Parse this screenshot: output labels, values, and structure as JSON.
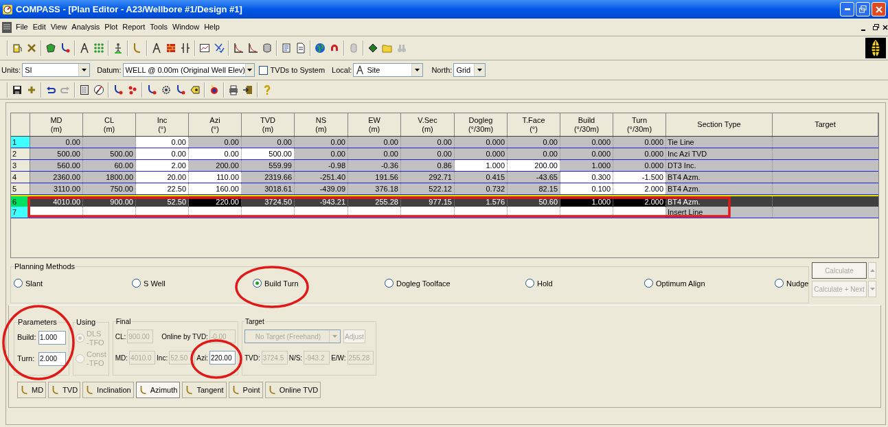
{
  "window": {
    "title": "COMPASS - [Plan Editor - A23/Wellbore #1/Design #1]"
  },
  "menu": [
    "File",
    "Edit",
    "View",
    "Analysis",
    "Plot",
    "Report",
    "Tools",
    "Window",
    "Help"
  ],
  "options": {
    "units": {
      "label": "Units:",
      "value": "SI"
    },
    "datum": {
      "label": "Datum:",
      "value": "WELL @ 0.00m (Original Well Elev)"
    },
    "tvds_to_system": {
      "label": "TVDs to System",
      "checked": false
    },
    "local": {
      "label": "Local:",
      "value": "Site"
    },
    "north": {
      "label": "North:",
      "value": "Grid"
    }
  },
  "table": {
    "columns": [
      {
        "name": "MD",
        "unit": "(m)"
      },
      {
        "name": "CL",
        "unit": "(m)"
      },
      {
        "name": "Inc",
        "unit": "(°)"
      },
      {
        "name": "Azi",
        "unit": "(°)"
      },
      {
        "name": "TVD",
        "unit": "(m)"
      },
      {
        "name": "NS",
        "unit": "(m)"
      },
      {
        "name": "EW",
        "unit": "(m)"
      },
      {
        "name": "V.Sec",
        "unit": "(m)"
      },
      {
        "name": "Dogleg",
        "unit": "(°/30m)"
      },
      {
        "name": "T.Face",
        "unit": "(°)"
      },
      {
        "name": "Build",
        "unit": "(°/30m)"
      },
      {
        "name": "Turn",
        "unit": "(°/30m)"
      },
      {
        "name": "Section Type"
      },
      {
        "name": "Target"
      }
    ],
    "rows": [
      {
        "number": "1",
        "kind": "tie",
        "selected": false,
        "section_type": "Tie Line",
        "cells": [
          {
            "text": "0.00",
            "editable": false
          },
          {
            "editable": false
          },
          {
            "text": "0.00",
            "editable": true
          },
          {
            "text": "0.00",
            "editable": false
          },
          {
            "text": "0.00",
            "editable": false
          },
          {
            "text": "0.00",
            "editable": false
          },
          {
            "text": "0.00",
            "editable": false
          },
          {
            "text": "0.00",
            "editable": false
          },
          {
            "text": "0.000",
            "editable": false
          },
          {
            "text": "0.00",
            "editable": false
          },
          {
            "text": "0.000",
            "editable": false
          },
          {
            "text": "0.000",
            "editable": false
          }
        ]
      },
      {
        "number": "2",
        "kind": "plan",
        "selected": false,
        "section_type": "Inc Azi TVD",
        "cells": [
          {
            "text": "500.00",
            "editable": false
          },
          {
            "text": "500.00",
            "editable": false
          },
          {
            "text": "0.00",
            "editable": true
          },
          {
            "text": "0.00",
            "editable": true
          },
          {
            "text": "500.00",
            "editable": true
          },
          {
            "text": "0.00",
            "editable": false
          },
          {
            "text": "0.00",
            "editable": false
          },
          {
            "text": "0.00",
            "editable": false
          },
          {
            "text": "0.000",
            "editable": false
          },
          {
            "text": "0.00",
            "editable": false
          },
          {
            "text": "0.000",
            "editable": false
          },
          {
            "text": "0.000",
            "editable": false
          }
        ]
      },
      {
        "number": "3",
        "kind": "plan",
        "selected": false,
        "section_type": "DT3 Inc.",
        "cells": [
          {
            "text": "560.00",
            "editable": false
          },
          {
            "text": "60.00",
            "editable": false
          },
          {
            "text": "2.00",
            "editable": true
          },
          {
            "text": "200.00",
            "editable": false
          },
          {
            "text": "559.99",
            "editable": false
          },
          {
            "text": "-0.98",
            "editable": false
          },
          {
            "text": "-0.36",
            "editable": false
          },
          {
            "text": "0.86",
            "editable": false
          },
          {
            "text": "1.000",
            "editable": true
          },
          {
            "text": "200.00",
            "editable": true
          },
          {
            "text": "1.000",
            "editable": false
          },
          {
            "text": "0.000",
            "editable": false
          }
        ]
      },
      {
        "number": "4",
        "kind": "plan",
        "selected": false,
        "section_type": "BT4 Azm.",
        "cells": [
          {
            "text": "2360.00",
            "editable": false
          },
          {
            "text": "1800.00",
            "editable": false
          },
          {
            "text": "20.00",
            "editable": true
          },
          {
            "text": "110.00",
            "editable": true
          },
          {
            "text": "2319.66",
            "editable": false
          },
          {
            "text": "-251.40",
            "editable": false
          },
          {
            "text": "191.56",
            "editable": false
          },
          {
            "text": "292.71",
            "editable": false
          },
          {
            "text": "0.415",
            "editable": false
          },
          {
            "text": "-43.65",
            "editable": false
          },
          {
            "text": "0.300",
            "editable": true
          },
          {
            "text": "-1.500",
            "editable": true
          }
        ]
      },
      {
        "number": "5",
        "kind": "plan",
        "selected": false,
        "section_type": "BT4 Azm.",
        "cells": [
          {
            "text": "3110.00",
            "editable": false
          },
          {
            "text": "750.00",
            "editable": false
          },
          {
            "text": "22.50",
            "editable": true
          },
          {
            "text": "160.00",
            "editable": true
          },
          {
            "text": "3018.61",
            "editable": false
          },
          {
            "text": "-439.09",
            "editable": false
          },
          {
            "text": "376.18",
            "editable": false
          },
          {
            "text": "522.12",
            "editable": false
          },
          {
            "text": "0.732",
            "editable": false
          },
          {
            "text": "82.15",
            "editable": false
          },
          {
            "text": "0.100",
            "editable": true
          },
          {
            "text": "2.000",
            "editable": true
          }
        ]
      },
      {
        "number": "6",
        "kind": "plan",
        "selected": true,
        "section_type": "BT4 Azm.",
        "cells": [
          {
            "text": "4010.00",
            "editable": false
          },
          {
            "text": "900.00",
            "editable": false
          },
          {
            "text": "52.50",
            "editable": false
          },
          {
            "text": "220.00",
            "editable": true
          },
          {
            "text": "3724.50",
            "editable": false
          },
          {
            "text": "-943.21",
            "editable": false
          },
          {
            "text": "255.28",
            "editable": false
          },
          {
            "text": "977.15",
            "editable": false
          },
          {
            "text": "1.576",
            "editable": false
          },
          {
            "text": "50.60",
            "editable": false
          },
          {
            "text": "1.000",
            "editable": true
          },
          {
            "text": "2.000",
            "editable": true
          }
        ]
      },
      {
        "number": "7",
        "kind": "insert",
        "selected": false,
        "section_type": "Insert Line",
        "cells": [
          {
            "editable": true
          },
          {
            "editable": true
          },
          {
            "editable": true
          },
          {
            "editable": true
          },
          {
            "editable": true
          },
          {
            "editable": true
          },
          {
            "editable": true
          },
          {
            "editable": true
          },
          {
            "editable": true
          },
          {
            "editable": true
          },
          {
            "editable": true
          },
          {
            "editable": true
          }
        ]
      }
    ]
  },
  "planning_methods": {
    "title": "Planning Methods",
    "options": [
      {
        "label": "Slant",
        "selected": false
      },
      {
        "label": "S Well",
        "selected": false
      },
      {
        "label": "Build Turn",
        "selected": true
      },
      {
        "label": "Dogleg Toolface",
        "selected": false
      },
      {
        "label": "Hold",
        "selected": false
      },
      {
        "label": "Optimum Align",
        "selected": false
      },
      {
        "label": "Nudge",
        "selected": false
      }
    ]
  },
  "calculate_buttons": [
    {
      "label": "Calculate",
      "disabled": true
    },
    {
      "label": "Calculate + Next",
      "disabled": true
    }
  ],
  "parameters": {
    "title": "Parameters",
    "fields": [
      {
        "label": "Build:",
        "value": "1.000"
      },
      {
        "label": "Turn:",
        "value": "2.000"
      }
    ]
  },
  "using": {
    "title": "Using",
    "disabled": true,
    "options": [
      {
        "lines": [
          "DLS",
          "-TFO"
        ],
        "selected": true
      },
      {
        "lines": [
          "Const",
          "-TFO"
        ],
        "selected": false
      }
    ]
  },
  "final": {
    "title": "Final",
    "rows": [
      [
        {
          "label": "CL:",
          "value": "900.00",
          "disabled": true
        },
        {
          "label": "Online by TVD:",
          "value": "-0.00",
          "disabled": true
        }
      ],
      [
        {
          "label": "MD:",
          "value": "4010.0",
          "disabled": true
        },
        {
          "label": "Inc:",
          "value": "52.50",
          "disabled": true
        },
        {
          "label": "Azi:",
          "value": "220.00",
          "disabled": false
        }
      ]
    ]
  },
  "target": {
    "title": "Target",
    "dropdown": {
      "value": "No Target (Freehand)",
      "disabled": true
    },
    "button": {
      "label": "Adjust",
      "disabled": true
    },
    "fields": [
      {
        "label": "TVD:",
        "value": "3724.5",
        "disabled": true
      },
      {
        "label": "N/S:",
        "value": "-943.2",
        "disabled": true
      },
      {
        "label": "E/W:",
        "value": "255.28",
        "disabled": true
      }
    ]
  },
  "mode_buttons": [
    {
      "label": "MD",
      "selected": false
    },
    {
      "label": "TVD",
      "selected": false
    },
    {
      "label": "Inclination",
      "selected": false
    },
    {
      "label": "Azimuth",
      "selected": true
    },
    {
      "label": "Tangent",
      "selected": false
    },
    {
      "label": "Point",
      "selected": false
    },
    {
      "label": "Online TVD",
      "selected": false
    }
  ]
}
